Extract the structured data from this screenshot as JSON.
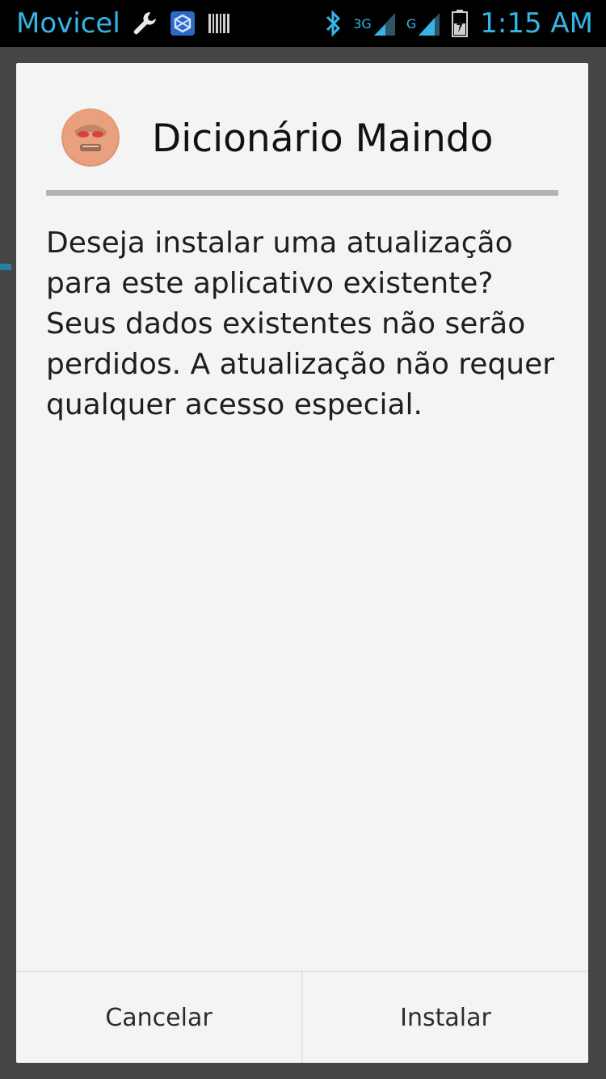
{
  "status_bar": {
    "carrier": "Movicel",
    "network_3g_label": "3G",
    "network_g_label": "G",
    "time": "1:15 AM",
    "icons": [
      "wrench-icon",
      "app-notification-icon",
      "barcode-icon",
      "bluetooth-icon",
      "signal-3g-icon",
      "signal-g-icon",
      "battery-charging-icon"
    ],
    "accent_color": "#34b5e5"
  },
  "dialog": {
    "app_name": "Dicionário Maindo",
    "app_icon": "app-face-icon",
    "message": "Deseja instalar uma atualização para este aplicativo existente? Seus dados existentes não serão perdidos. A atualização não requer qualquer acesso especial.",
    "buttons": {
      "cancel": "Cancelar",
      "install": "Instalar"
    }
  }
}
